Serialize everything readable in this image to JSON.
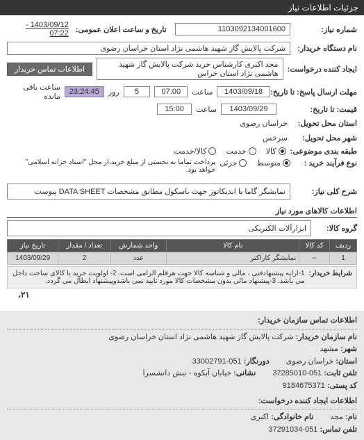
{
  "header": {
    "title": "جزئیات اطلاعات نیاز"
  },
  "fields": {
    "request_no_label": "شماره نیاز:",
    "request_no": "1103092134001600",
    "announce_label": "تاریخ و ساعت اعلان عمومی:",
    "announce_value": "1403/09/12 - 07:22",
    "buyer_org_label": "نام دستگاه خریدار:",
    "buyer_org": "شرکت پالایش گاز شهید هاشمی نژاد    استان خراسان رضوی",
    "creator_label": "ایجاد کننده درخواست:",
    "creator": "مجد اکبری کارشناس خرید شرکت پالایش گاز شهید هاشمی نژاد    استان خراس",
    "contact_btn": "اطلاعات تماس خریدار",
    "deadline_label": "مهلت ارسال پاسخ: تا تاریخ:",
    "deadline_date": "1403/09/18",
    "time_label": "ساعت",
    "deadline_time": "07:00",
    "deadline_days": "5",
    "day_word": "روز",
    "remaining": "23:24:45",
    "remaining_label": "ساعت باقی مانده",
    "until_label": "قیمت: تا تاریخ:",
    "until_date": "1403/09/29",
    "until_time": "15:00",
    "province_label": "استان محل تحویل:",
    "province": "خراسان رضوی",
    "city_label": "شهر محل تحویل:",
    "city": "سرخس",
    "category_label": "طبقه بندی موضوعی:",
    "radios": {
      "goods": "کالا",
      "service": "خدمت",
      "both": "کالا/خدمت"
    },
    "process_label": "نوع فرآیند خرید :",
    "radios2": {
      "medium": "متوسط",
      "partial": "جزئی"
    },
    "process_note": "پرداخت تماما به نخستی از مبلغ خرید،از محل \"اسناد خزانه اسلامی\" خواهد بود.",
    "keyword_label": "شرح کلی نیاز:",
    "keyword": "نمایشگر گاما یا اندیکاتور جهت باسکول مطابق مشخصات DATA SHEET پیوست",
    "goods_section": "اطلاعات کالاهای مورد نیاز",
    "group_label": "گروه کالا:",
    "group": "ابزارآلات الکتریکی"
  },
  "table": {
    "headers": [
      "ردیف",
      "کد کالا",
      "نام کالا",
      "واحد شمارش",
      "تعداد / مقدار",
      "تاریخ نیاز"
    ],
    "rows": [
      [
        "1",
        "--",
        "نمایشگر کاراکتر",
        "عدد",
        "2",
        "1403/09/29"
      ]
    ]
  },
  "conditions": {
    "label": "شرایط خریدار:",
    "text": "1-ارایه پیشنهادفنی ، مالی و شناسه کالا جهت هرقلم الزامی است. 2- اولویت خرید با کالای ساخت داخل می باشد. 3-پیشنهاد مالی بدون مشخصات کالا مورد تایید نمی باشدوپیشنهاد ابطال می گردد.",
    "page_num": "،۲۱"
  },
  "contact": {
    "section_title": "اطلاعات تماس سازمان خریدار:",
    "org_label": "نام سازمان خریدار:",
    "org": "شرکت پالایش گاز شهید هاشمی نژاد استان خراسان رضوی",
    "city_label": "شهر:",
    "city": "مشهد",
    "province_label": "استان:",
    "province": "خراسان رضوی",
    "fax_label": "دورنگار:",
    "fax": "051-33002791",
    "phone_label": "تلفن ثابت:",
    "phone": "051-37285010",
    "address_label": "نشانی:",
    "address": "خیابان آبکوه - نبش دانشسرا",
    "postal_label": "کد پستی:",
    "postal": "9184675371",
    "section2_title": "اطلاعات ایجاد کننده درخواست:",
    "first_label": "نام:",
    "first": "مجد",
    "last_label": "نام خانوادگی:",
    "last": "اکبری",
    "contact_phone_label": "تلفن تماس:",
    "contact_phone": "051-37291034"
  }
}
